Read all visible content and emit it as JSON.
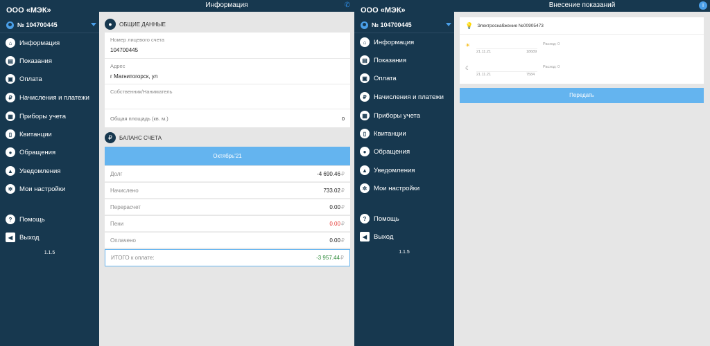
{
  "org_name": "ООО «МЭК»",
  "account_number": "№ 104700445",
  "nav": {
    "information": "Информация",
    "readings": "Показания",
    "payment": "Оплата",
    "charges": "Начисления и платежи",
    "meters": "Приборы учета",
    "receipts": "Квитанции",
    "requests": "Обращения",
    "notifications": "Уведомления",
    "settings": "Мои настройки",
    "help": "Помощь",
    "logout": "Выход"
  },
  "version": "1.1.5",
  "left_screen": {
    "title": "Информация",
    "general_section": "ОБЩИЕ ДАННЫЕ",
    "account_label": "Номер лицевого счета",
    "account_value": "104700445",
    "address_label": "Адрес",
    "address_value": "г Магнитогорск, ул",
    "owner_label": "Собственник/Наниматель",
    "area_label": "Общая площадь (кв. м.)",
    "area_value": "0",
    "balance_section": "БАЛАНС СЧЕТА",
    "month": "Октябрь'21",
    "currency": "₽",
    "debt_label": "Долг",
    "debt_value": "-4 690.46",
    "charged_label": "Начислено",
    "charged_value": "733.02",
    "recalc_label": "Перерасчет",
    "recalc_value": "0.00",
    "penalty_label": "Пени",
    "penalty_value": "0.00",
    "paid_label": "Оплачено",
    "paid_value": "0.00",
    "total_label": "ИТОГО к оплате:",
    "total_value": "-3 957.44"
  },
  "right_screen": {
    "title": "Внесение показаний",
    "meter_name": "Электроснабжение №00905473",
    "day_consumption": "Расход: 0",
    "day_date": "21.11.21",
    "day_prev": "18689",
    "night_consumption": "Расход: 0",
    "night_date": "21.11.21",
    "night_prev": "7584",
    "submit": "Передать"
  },
  "colors": {
    "sidebar": "#17384f",
    "accent": "#64b4ef",
    "negative": "#e53935",
    "positive": "#2e8b3a"
  }
}
